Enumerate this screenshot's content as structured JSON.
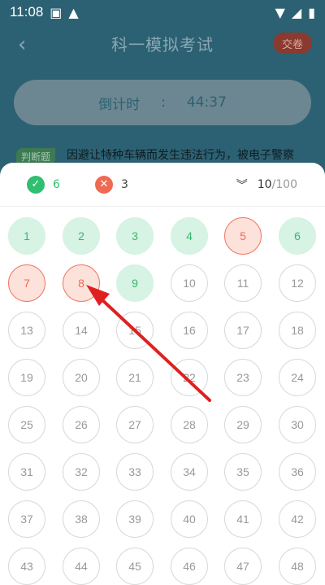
{
  "status": {
    "time": "11:08"
  },
  "header": {
    "back_icon": "chevron-left-icon",
    "title": "科一模拟考试",
    "submit_label": "交卷"
  },
  "timer": {
    "label": "倒计时",
    "separator": ":",
    "value": "44:37"
  },
  "question": {
    "type": "判断题",
    "text": "因避让特种车辆而发生违法行为，被电子警察"
  },
  "summary": {
    "correct_count": "6",
    "wrong_count": "3",
    "current": "10",
    "total": "/100"
  },
  "colors": {
    "correct": "#2fbf6f",
    "wrong": "#ef6a52",
    "annotation_arrow": "#e02020"
  },
  "grid": {
    "numbers": [
      "1",
      "2",
      "3",
      "4",
      "5",
      "6",
      "7",
      "8",
      "9",
      "10",
      "11",
      "12",
      "13",
      "14",
      "15",
      "16",
      "17",
      "18",
      "19",
      "20",
      "21",
      "22",
      "23",
      "24",
      "25",
      "26",
      "27",
      "28",
      "29",
      "30",
      "31",
      "32",
      "33",
      "34",
      "35",
      "36",
      "37",
      "38",
      "39",
      "40",
      "41",
      "42",
      "43",
      "44",
      "45",
      "46",
      "47",
      "48"
    ],
    "correct": [
      1,
      2,
      3,
      4,
      6,
      9
    ],
    "wrong": [
      5,
      7,
      8
    ]
  }
}
